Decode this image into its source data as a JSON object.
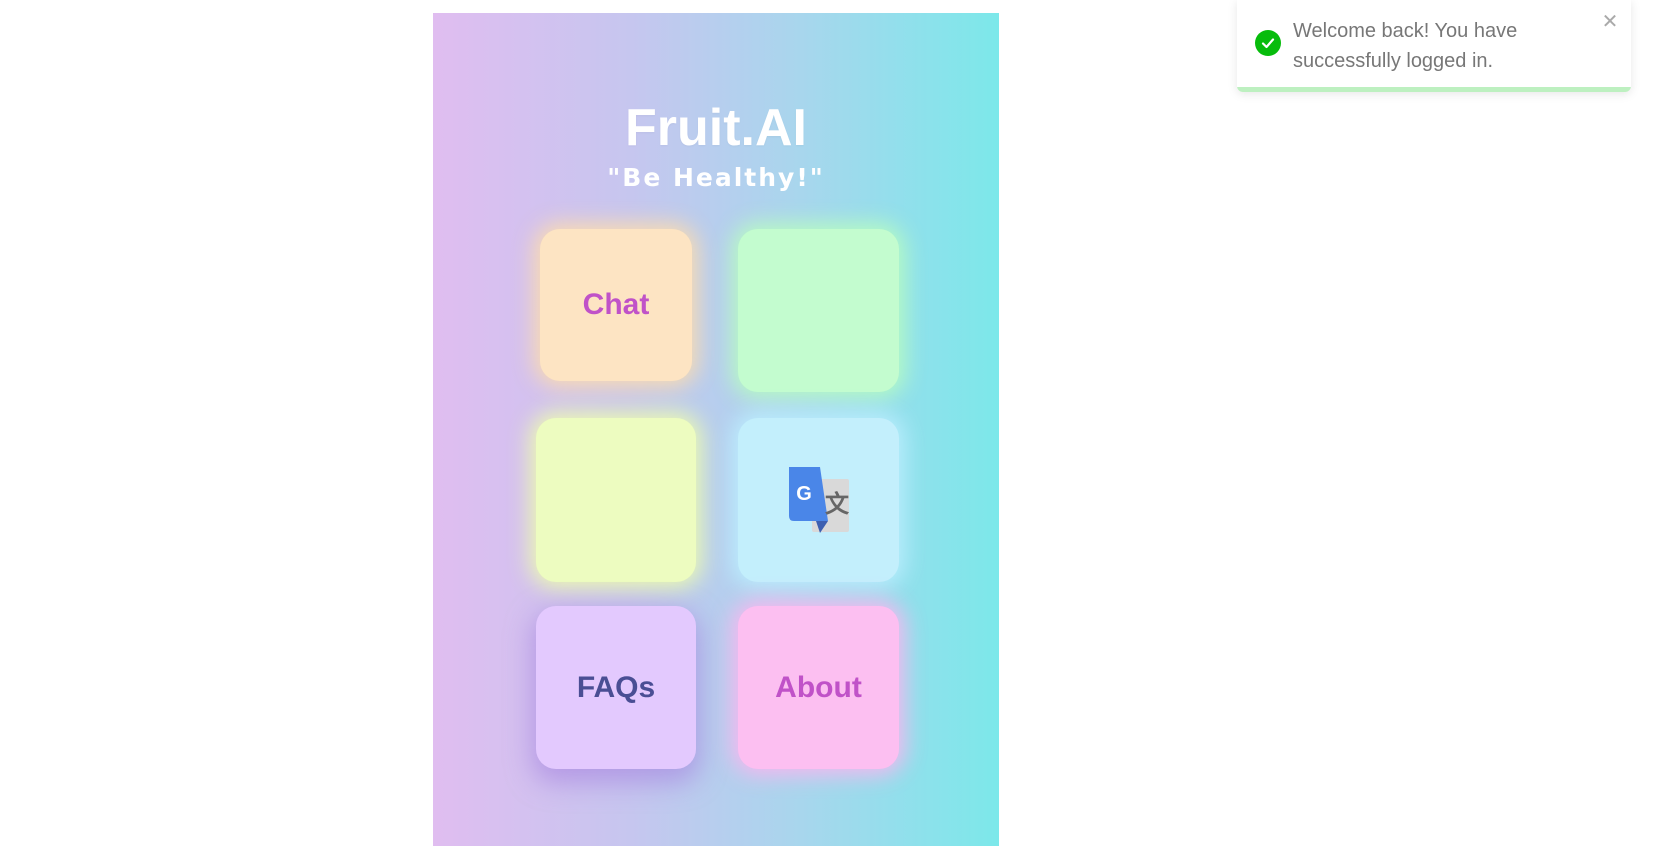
{
  "app": {
    "title": "Fruit.AI",
    "tagline": "\"Be Healthy!\"",
    "tiles": {
      "chat": {
        "label": "Chat",
        "color": "#fde4c3"
      },
      "green": {
        "label": "",
        "color": "#c3fccf"
      },
      "lime": {
        "label": "",
        "color": "#edfcc0"
      },
      "translate": {
        "icon": "google-translate-icon",
        "color": "#c3effc"
      },
      "faqs": {
        "label": "FAQs",
        "color": "#e3c9fe"
      },
      "about": {
        "label": "About",
        "color": "#fcbff1"
      }
    }
  },
  "toast": {
    "message": "Welcome back! You have successfully logged in.",
    "icon": "check-circle-icon",
    "close_icon": "close-icon",
    "close_glyph": "✕",
    "status_color": "#07bc0c",
    "progress": 1.0
  }
}
